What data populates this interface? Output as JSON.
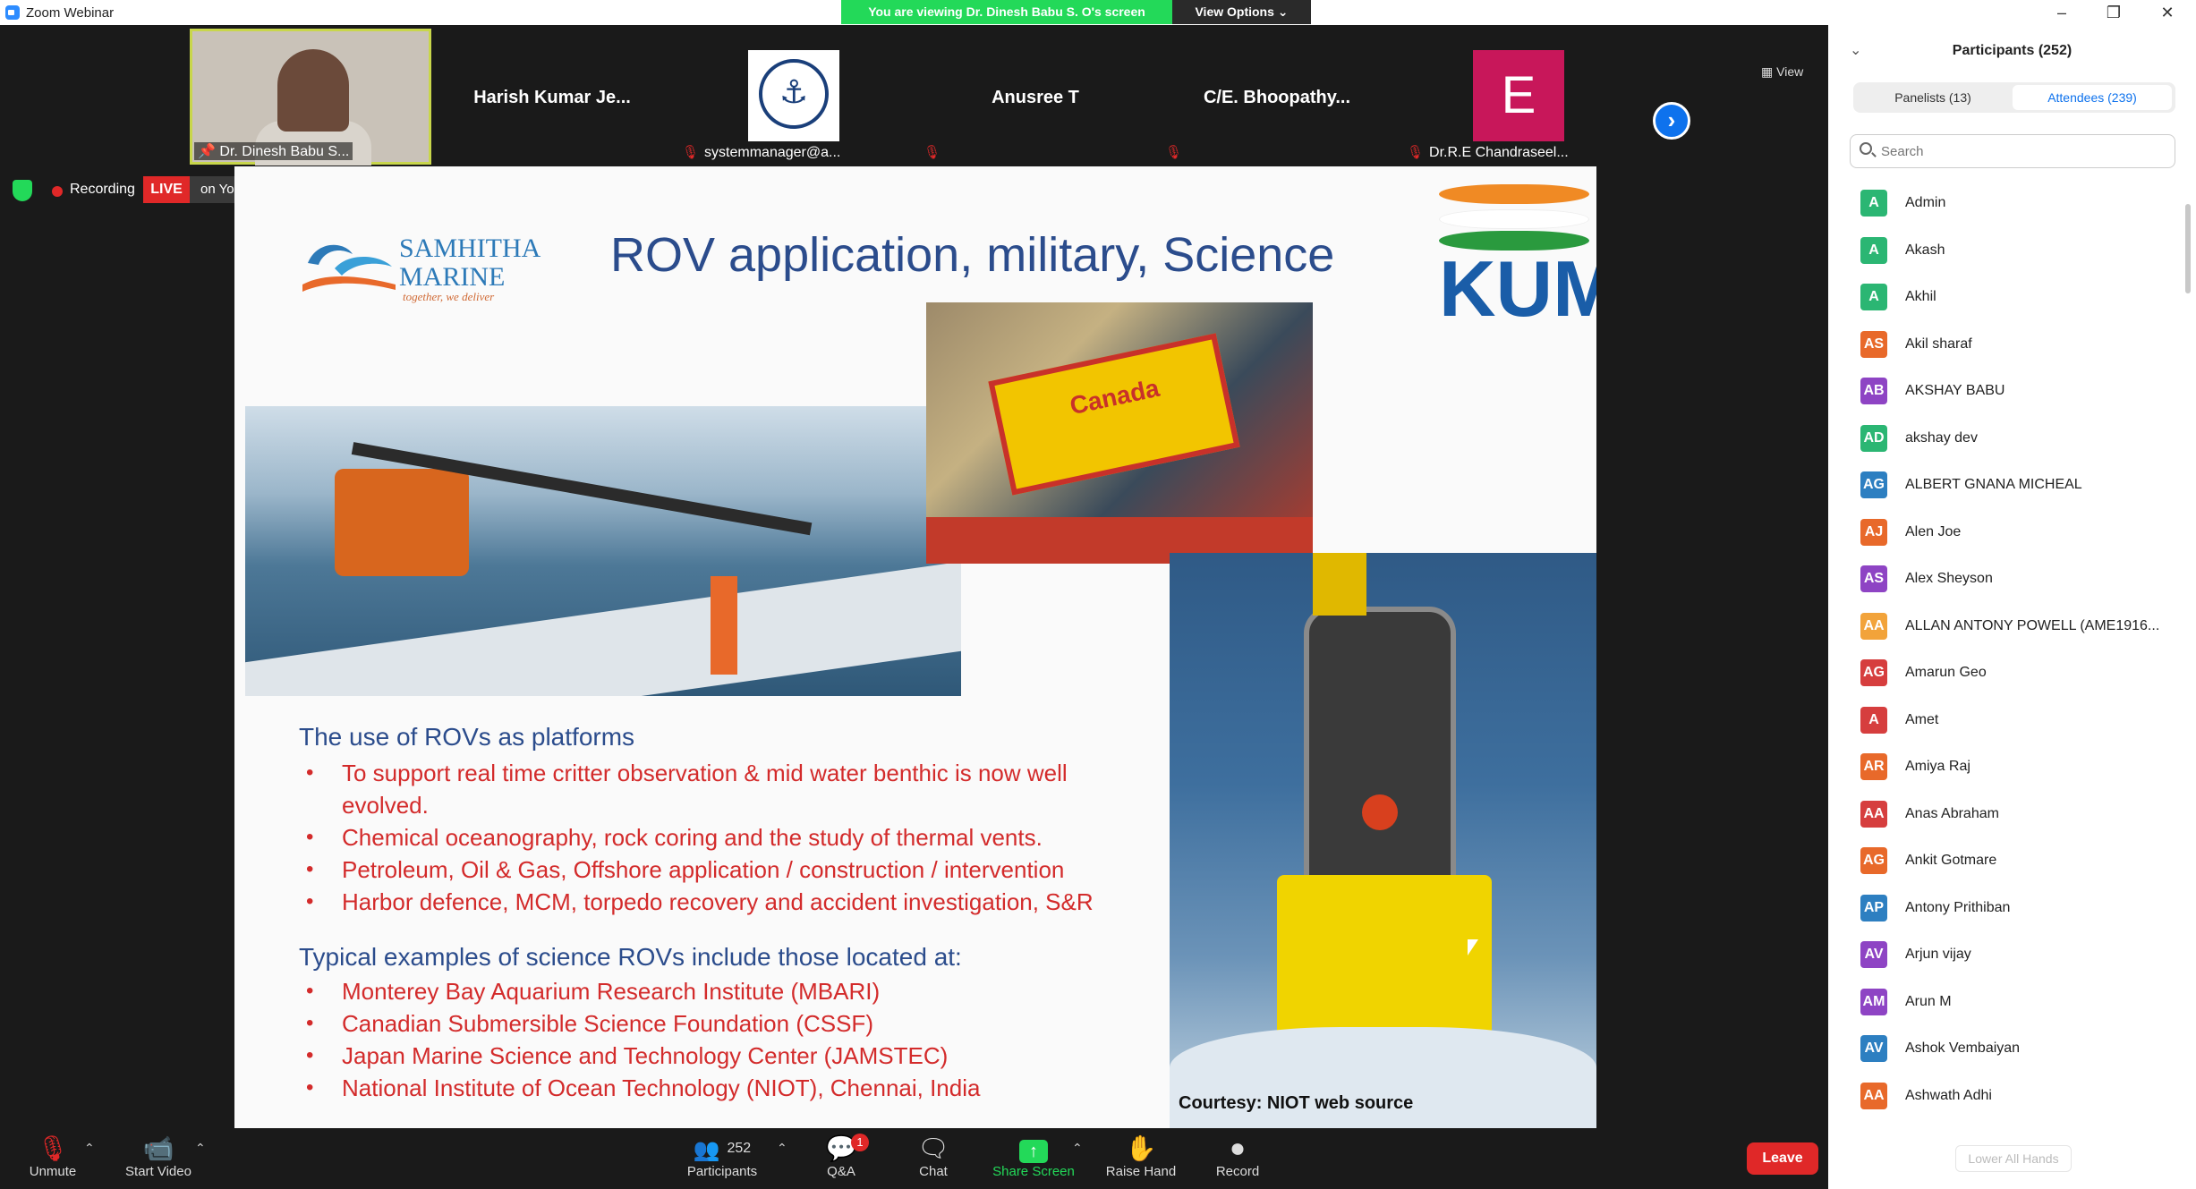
{
  "window": {
    "title": "Zoom Webinar"
  },
  "banner": {
    "viewing": "You are viewing Dr. Dinesh Babu S. O's screen",
    "view_options": "View Options"
  },
  "strip": {
    "tiles": [
      {
        "name": "",
        "footer": "Dr. Dinesh Babu S..."
      },
      {
        "name": "Harish Kumar Je...",
        "footer": ""
      },
      {
        "name": "",
        "footer": "systemmanager@a..."
      },
      {
        "name": "Anusree T",
        "footer": ""
      },
      {
        "name": "C/E.  Bhoopathy...",
        "footer": ""
      },
      {
        "name": "",
        "footer": "Dr.R.E Chandraseel...",
        "avatar_letter": "E"
      }
    ],
    "view_label": "View"
  },
  "status": {
    "recording": "Recording",
    "live": "LIVE",
    "youtube": "on YouTube"
  },
  "slide": {
    "title": "ROV application, military, Science",
    "brand_top": "SAMHITHA",
    "brand_bottom": "MARINE",
    "brand_tag": "together, we deliver",
    "kum": "KUM",
    "heading1": "The use of ROVs as platforms",
    "bullets1": [
      "To support real time critter observation & mid water benthic is now well evolved.",
      "Chemical oceanography, rock coring and the study of thermal vents.",
      "Petroleum, Oil & Gas, Offshore application / construction / intervention",
      "Harbor defence, MCM, torpedo recovery and accident investigation, S&R"
    ],
    "heading2": "Typical examples of science ROVs include those located at:",
    "bullets2": [
      "Monterey Bay Aquarium Research Institute (MBARI)",
      "Canadian Submersible Science Foundation  (CSSF)",
      "Japan Marine Science and Technology Center (JAMSTEC)",
      "National Institute of Ocean Technology (NIOT), Chennai, India"
    ],
    "courtesy": "Courtesy: NIOT web source",
    "photo_text": "Canada"
  },
  "toolbar": {
    "unmute": "Unmute",
    "start_video": "Start Video",
    "participants": "Participants",
    "participants_count": "252",
    "qa": "Q&A",
    "qa_badge": "1",
    "chat": "Chat",
    "share": "Share Screen",
    "raise_hand": "Raise Hand",
    "record": "Record",
    "leave": "Leave"
  },
  "panel": {
    "title": "Participants (252)",
    "tabs": [
      {
        "label": "Panelists (13)"
      },
      {
        "label": "Attendees (239)"
      }
    ],
    "search_placeholder": "Search",
    "participants": [
      {
        "initials": "A",
        "name": "Admin",
        "color": "#2bb673"
      },
      {
        "initials": "A",
        "name": "Akash",
        "color": "#2bb673"
      },
      {
        "initials": "A",
        "name": "Akhil",
        "color": "#2bb673"
      },
      {
        "initials": "AS",
        "name": "Akil sharaf",
        "color": "#e8692a"
      },
      {
        "initials": "AB",
        "name": "AKSHAY BABU",
        "color": "#8e44c4"
      },
      {
        "initials": "AD",
        "name": "akshay dev",
        "color": "#2bb673"
      },
      {
        "initials": "AG",
        "name": "ALBERT GNANA MICHEAL",
        "color": "#2d7fc1"
      },
      {
        "initials": "AJ",
        "name": "Alen Joe",
        "color": "#e8692a"
      },
      {
        "initials": "AS",
        "name": "Alex Sheyson",
        "color": "#8e44c4"
      },
      {
        "initials": "AA",
        "name": "ALLAN ANTONY POWELL (AME1916...",
        "color": "#f2a33a"
      },
      {
        "initials": "AG",
        "name": "Amarun Geo",
        "color": "#d63e3e"
      },
      {
        "initials": "A",
        "name": "Amet",
        "color": "#d63e3e"
      },
      {
        "initials": "AR",
        "name": "Amiya Raj",
        "color": "#e8692a"
      },
      {
        "initials": "AA",
        "name": "Anas Abraham",
        "color": "#d63e3e"
      },
      {
        "initials": "AG",
        "name": "Ankit Gotmare",
        "color": "#e8692a"
      },
      {
        "initials": "AP",
        "name": "Antony Prithiban",
        "color": "#2d7fc1"
      },
      {
        "initials": "AV",
        "name": "Arjun vijay",
        "color": "#8e44c4"
      },
      {
        "initials": "AM",
        "name": "Arun M",
        "color": "#8e44c4"
      },
      {
        "initials": "AV",
        "name": "Ashok Vembaiyan",
        "color": "#2d7fc1"
      },
      {
        "initials": "AA",
        "name": "Ashwath Adhi",
        "color": "#e8692a"
      }
    ],
    "lower_all_hands": "Lower All Hands"
  }
}
